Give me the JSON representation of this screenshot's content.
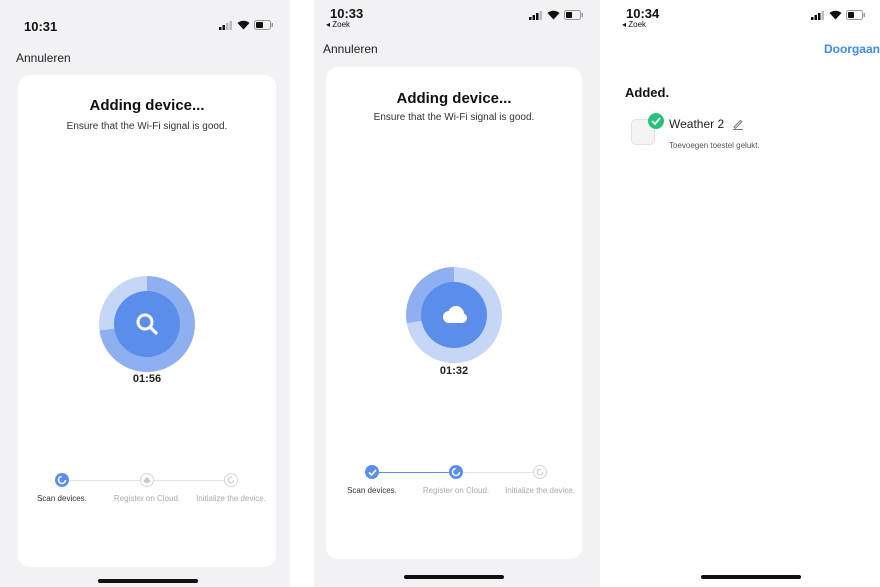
{
  "screen1": {
    "time": "10:31",
    "cancel": "Annuleren",
    "title": "Adding device...",
    "subtitle": "Ensure that the Wi-Fi signal is good.",
    "timer": "01:56",
    "steps": [
      "Scan devices.",
      "Register on Cloud.",
      "Initialize the device."
    ],
    "icon": "search-icon"
  },
  "screen2": {
    "time": "10:33",
    "back": "◂ Zoek",
    "cancel": "Annuleren",
    "title": "Adding device...",
    "subtitle": "Ensure that the Wi-Fi signal is good.",
    "timer": "01:32",
    "steps": [
      "Scan devices.",
      "Register on Cloud.",
      "Initialize the device."
    ],
    "icon": "cloud-icon"
  },
  "screen3": {
    "time": "10:34",
    "back": "◂ Zoek",
    "proceed": "Doorgaan",
    "added_heading": "Added.",
    "device_name": "Weather 2",
    "device_status": "Toevoegen toestel gelukt."
  },
  "colors": {
    "accent": "#5a8eea",
    "link": "#3d8af0",
    "success": "#27c27a"
  }
}
